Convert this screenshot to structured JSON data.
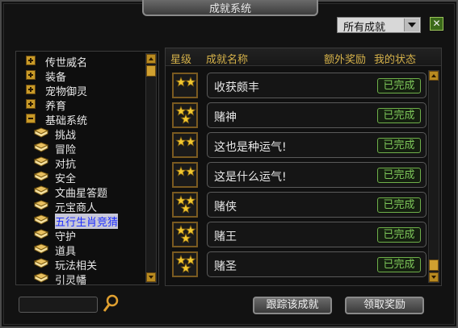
{
  "window": {
    "title": "成就系统",
    "close_label": "✕"
  },
  "filter": {
    "selected": "所有成就"
  },
  "tree": {
    "items": [
      {
        "label": "传世威名",
        "kind": "group",
        "expanded": false
      },
      {
        "label": "装备",
        "kind": "group",
        "expanded": false
      },
      {
        "label": "宠物御灵",
        "kind": "group",
        "expanded": false
      },
      {
        "label": "养育",
        "kind": "group",
        "expanded": false
      },
      {
        "label": "基础系统",
        "kind": "group",
        "expanded": true
      },
      {
        "label": "挑战",
        "kind": "leaf"
      },
      {
        "label": "冒险",
        "kind": "leaf"
      },
      {
        "label": "对抗",
        "kind": "leaf"
      },
      {
        "label": "安全",
        "kind": "leaf"
      },
      {
        "label": "文曲星答题",
        "kind": "leaf"
      },
      {
        "label": "元宝商人",
        "kind": "leaf"
      },
      {
        "label": "五行生肖竞猜",
        "kind": "leaf",
        "selected": true
      },
      {
        "label": "守护",
        "kind": "leaf"
      },
      {
        "label": "道具",
        "kind": "leaf"
      },
      {
        "label": "玩法相关",
        "kind": "leaf"
      },
      {
        "label": "引灵幡",
        "kind": "leaf"
      }
    ]
  },
  "list": {
    "headers": {
      "stars": "星级",
      "name": "成就名称",
      "reward": "额外奖励",
      "status": "我的状态"
    },
    "rows": [
      {
        "stars": 2,
        "name": "收获颇丰",
        "status": "已完成"
      },
      {
        "stars": 3,
        "name": "赌神",
        "status": "已完成"
      },
      {
        "stars": 2,
        "name": "这也是种运气!",
        "status": "已完成"
      },
      {
        "stars": 2,
        "name": "这是什么运气!",
        "status": "已完成"
      },
      {
        "stars": 3,
        "name": "赌侠",
        "status": "已完成"
      },
      {
        "stars": 3,
        "name": "赌王",
        "status": "已完成"
      },
      {
        "stars": 3,
        "name": "赌圣",
        "status": "已完成"
      }
    ]
  },
  "buttons": {
    "track": "跟踪该成就",
    "claim": "领取奖励"
  },
  "colors": {
    "header_text": "#d6b24a",
    "done_text": "#7ec85a",
    "selected_text": "#1e2eff"
  }
}
